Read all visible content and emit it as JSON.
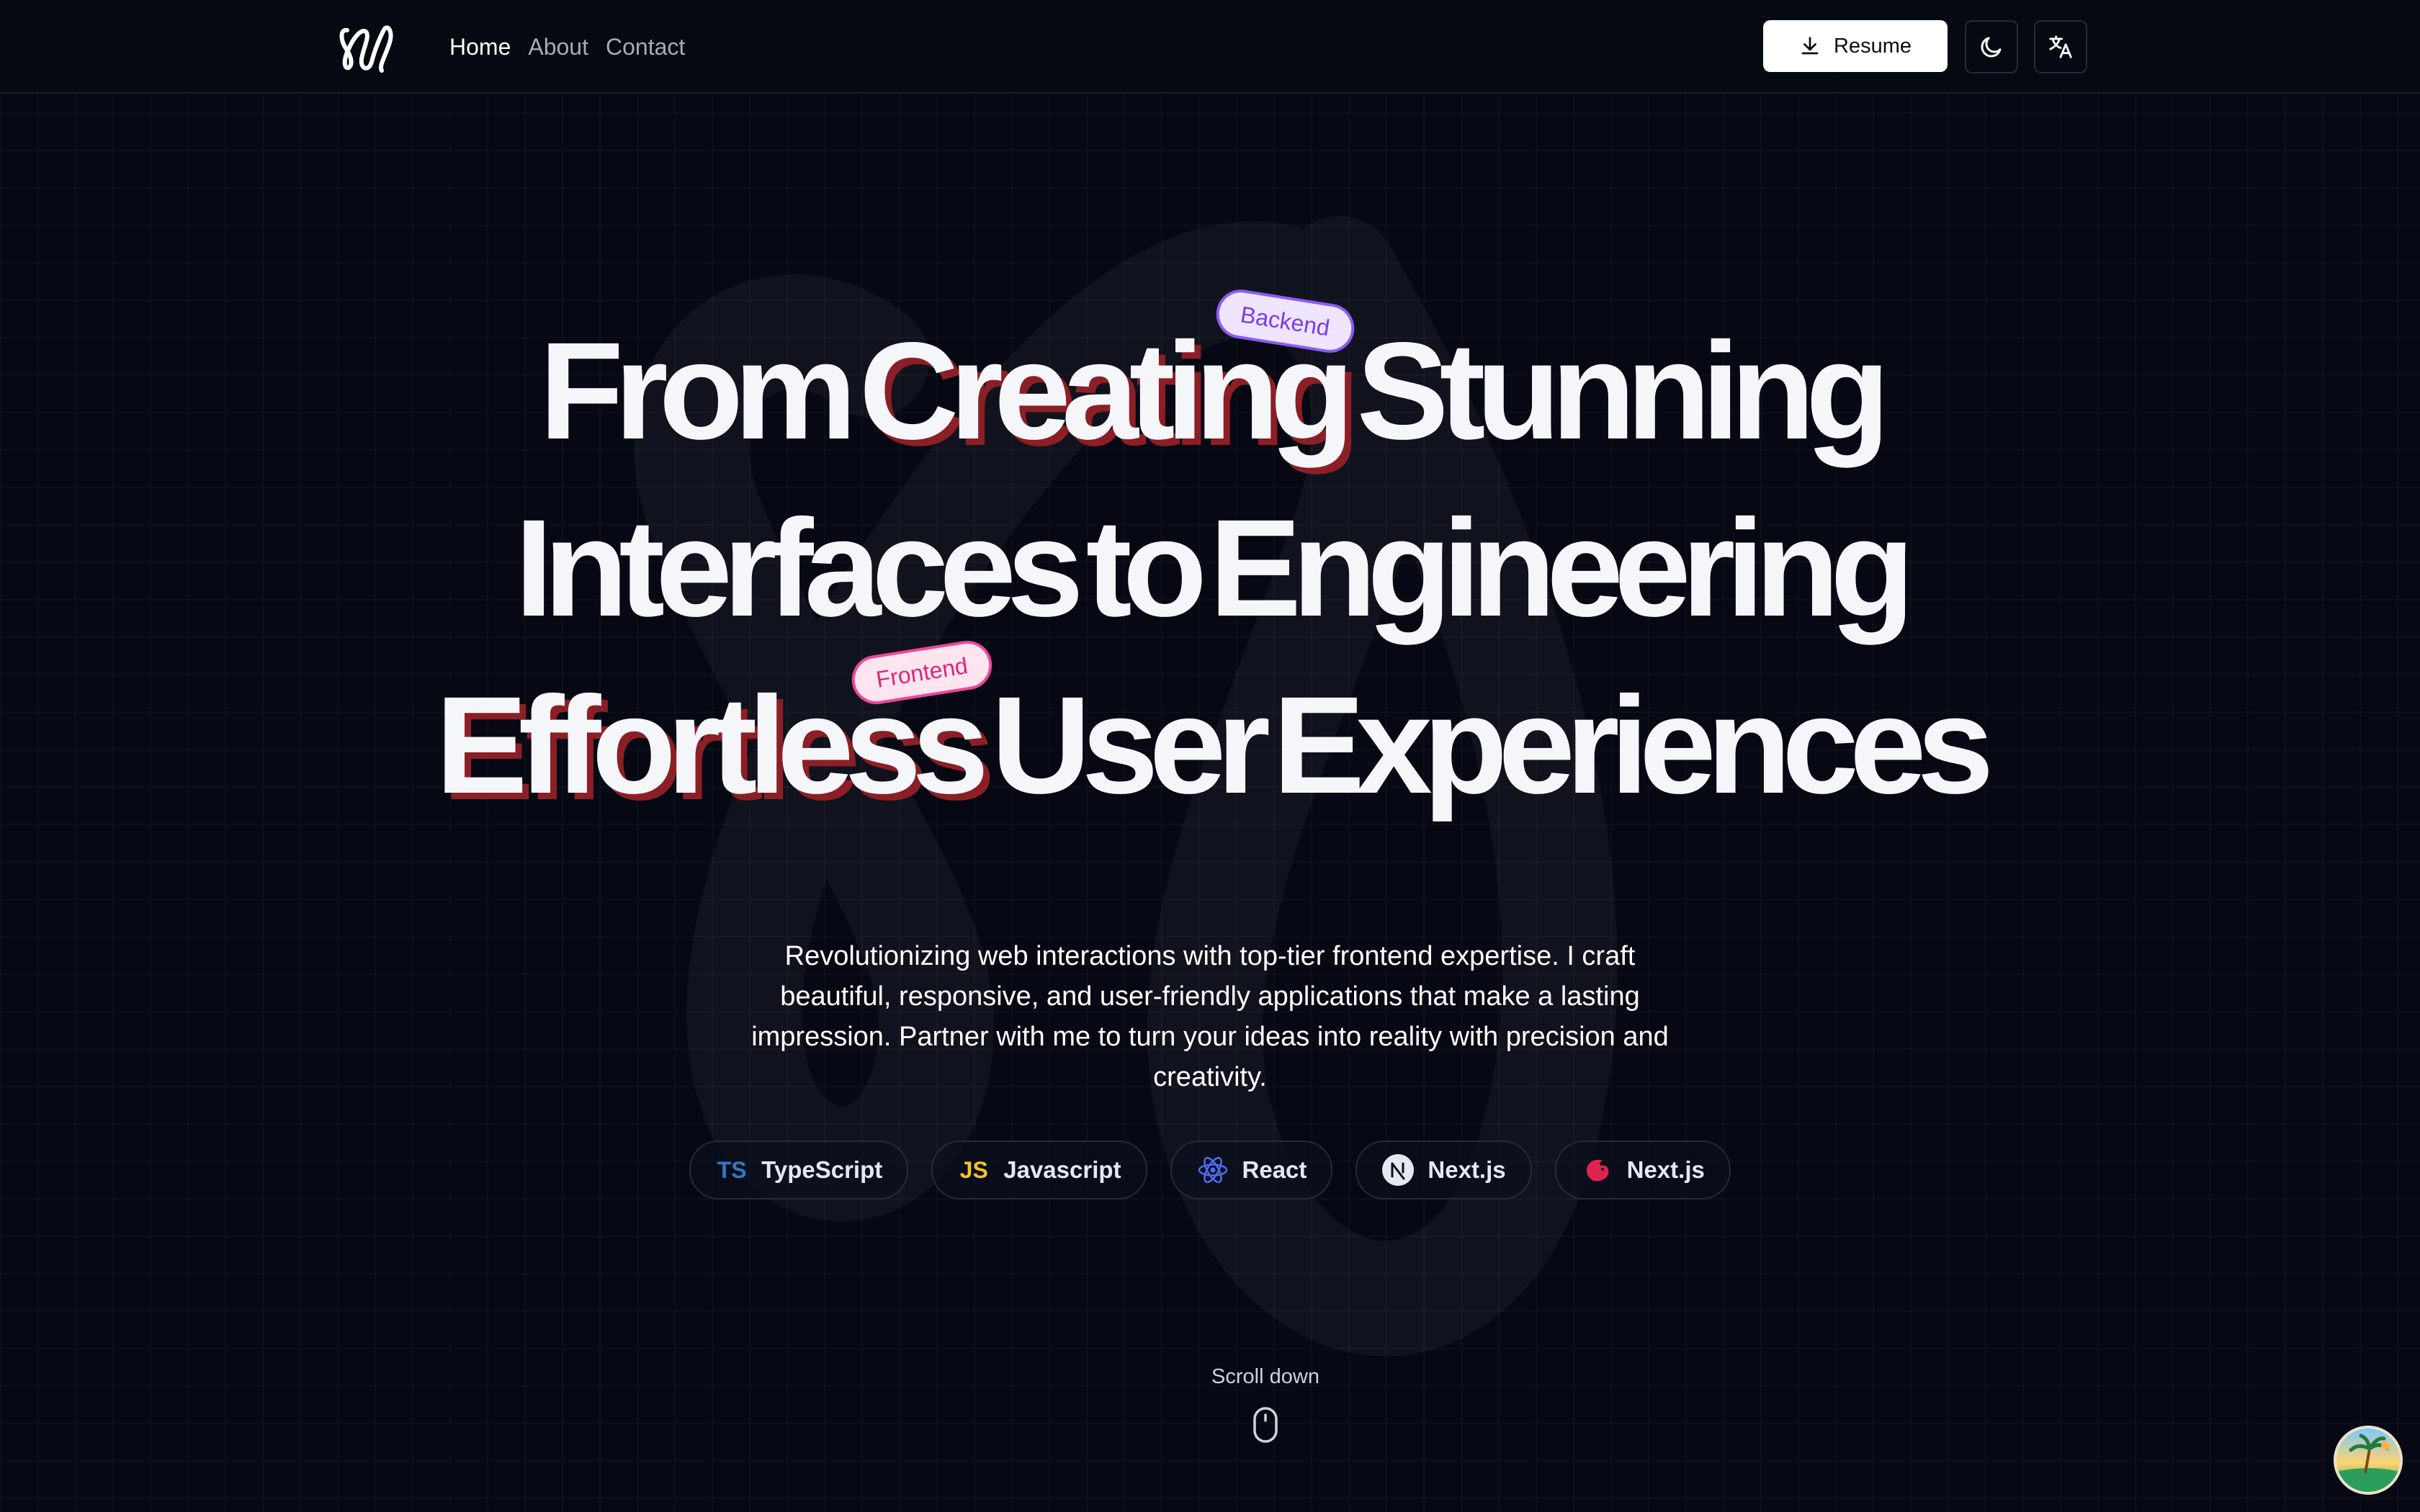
{
  "header": {
    "logo_icon": "scribble-logo-icon",
    "nav": [
      {
        "label": "Home",
        "active": true
      },
      {
        "label": "About",
        "active": false
      },
      {
        "label": "Contact",
        "active": false
      }
    ],
    "resume_label": "Resume",
    "resume_icon": "download-icon",
    "theme_icon": "moon-icon",
    "language_icon": "translate-icon"
  },
  "hero": {
    "line1": {
      "plain": "From",
      "highlight": "Creating",
      "rest": "Stunning"
    },
    "line2": {
      "w1": "Interfaces",
      "w2": "to",
      "w3": "Engineering"
    },
    "line3": {
      "highlight": "Effortless",
      "w1": "User",
      "w2": "Experiences"
    },
    "tag_backend": "Backend",
    "tag_frontend": "Frontend",
    "highlight_shadow_color": "#8b1f25"
  },
  "subtitle": "Revolutionizing web interactions with top-tier frontend expertise. I craft beautiful, responsive, and user-friendly applications that make a lasting impression. Partner with me to turn your ideas into reality with precision and creativity.",
  "tech": [
    {
      "icon_text": "TS",
      "label": "TypeScript",
      "color": "#3178c6"
    },
    {
      "icon_text": "JS",
      "label": "Javascript",
      "color": "#f7df1e"
    },
    {
      "icon_text": "",
      "label": "React",
      "color": "#4f6cf0"
    },
    {
      "icon_text": "N",
      "label": "Next.js",
      "color": "#e6e8ef"
    },
    {
      "icon_text": "",
      "label": "Next.js",
      "color": "#e0234e"
    }
  ],
  "scroll": {
    "label": "Scroll down",
    "icon": "mouse-icon"
  },
  "avatar_icon": "beach-avatar-icon",
  "colors": {
    "background": "#060913",
    "backend_tag": "#8b5cf6",
    "frontend_tag": "#ec4899"
  }
}
